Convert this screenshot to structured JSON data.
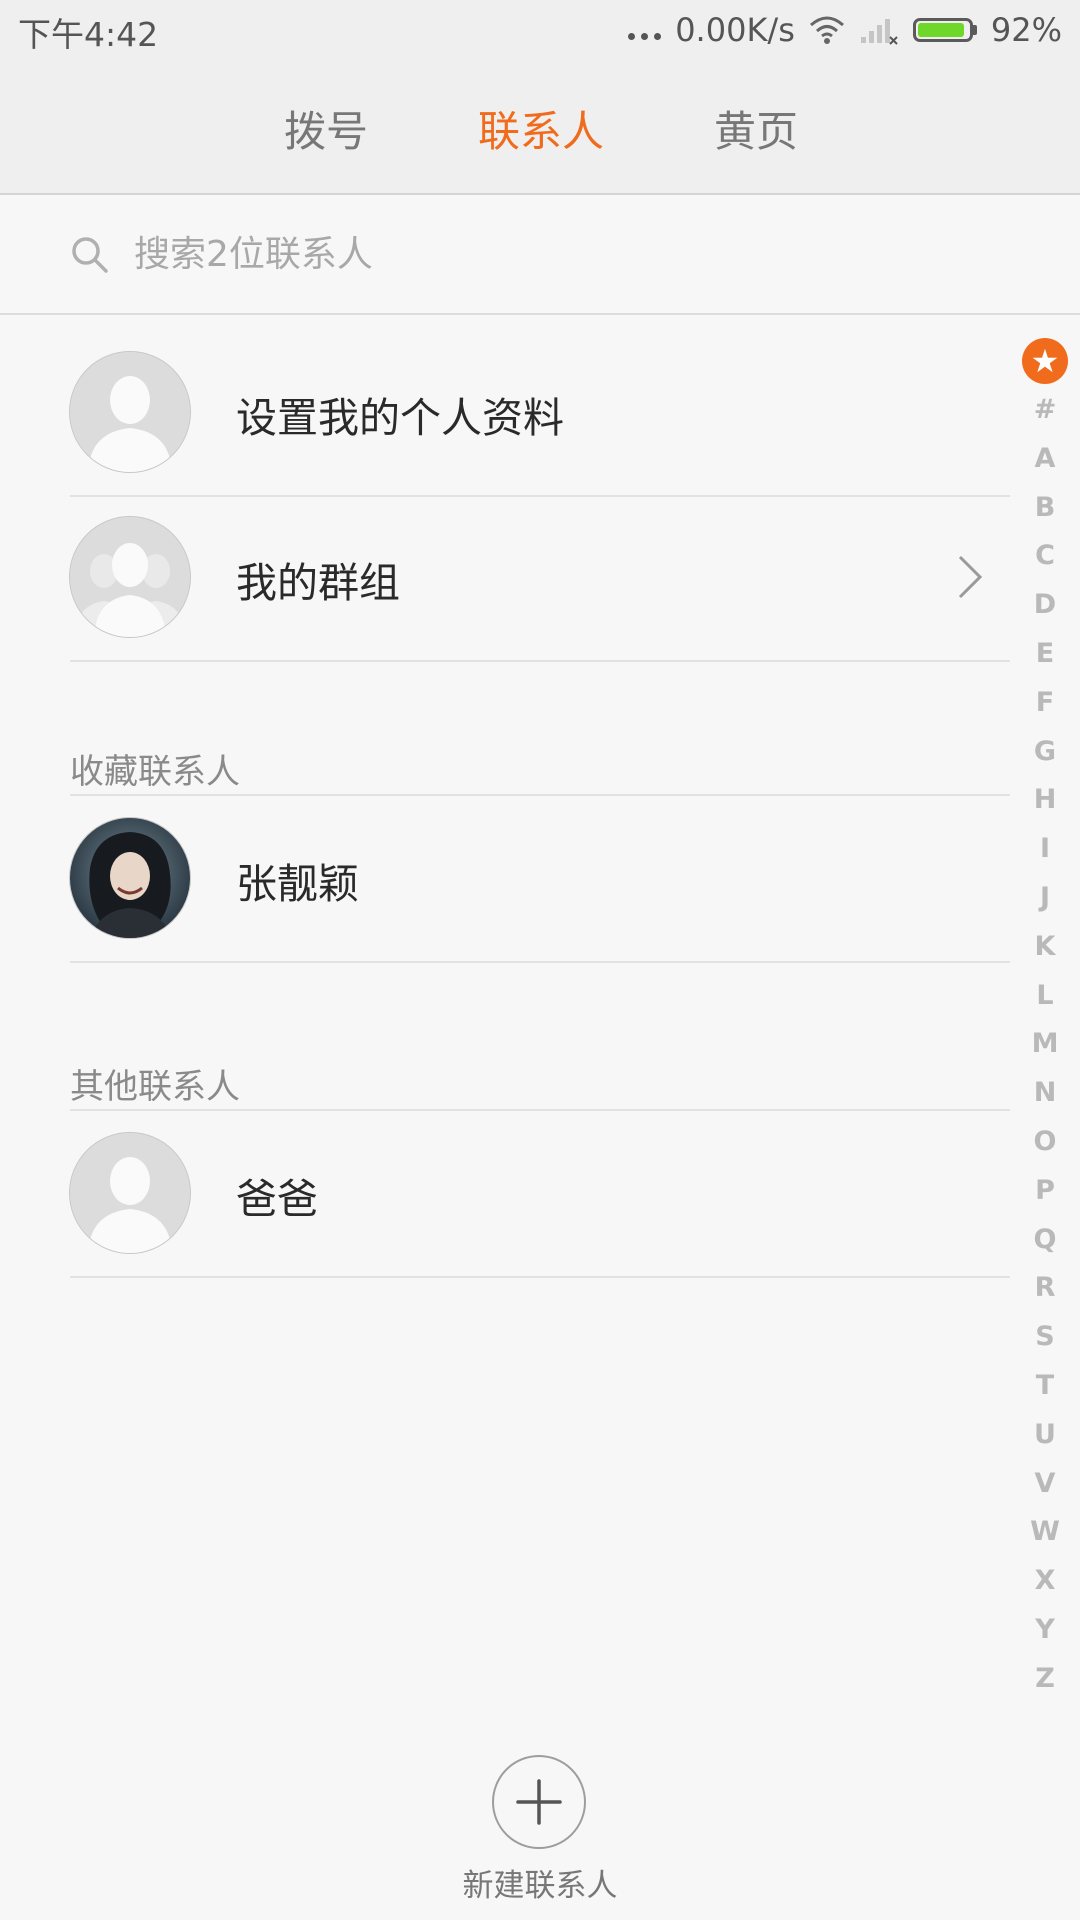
{
  "status": {
    "time": "下午4:42",
    "speed": "0.00K/s",
    "battery": "92%",
    "battery_level": 0.92,
    "icons": [
      "more-dots-icon",
      "wifi-icon",
      "signal-off-icon",
      "battery-icon"
    ]
  },
  "tabs": [
    {
      "label": "拨号",
      "active": false
    },
    {
      "label": "联系人",
      "active": true
    },
    {
      "label": "黄页",
      "active": false
    }
  ],
  "search": {
    "placeholder": "搜索2位联系人",
    "value": ""
  },
  "top_items": [
    {
      "label": "设置我的个人资料",
      "icon": "person-avatar-icon"
    },
    {
      "label": "我的群组",
      "icon": "group-avatar-icon",
      "trailing": "chevron-right-icon"
    }
  ],
  "sections": [
    {
      "title": "收藏联系人",
      "contacts": [
        {
          "name": "张靓颖",
          "avatar": "photo"
        }
      ]
    },
    {
      "title": "其他联系人",
      "contacts": [
        {
          "name": "爸爸",
          "avatar": "default"
        }
      ]
    }
  ],
  "index_bar": {
    "favorite_symbol": "★",
    "letters": [
      "#",
      "A",
      "B",
      "C",
      "D",
      "E",
      "F",
      "G",
      "H",
      "I",
      "J",
      "K",
      "L",
      "M",
      "N",
      "O",
      "P",
      "Q",
      "R",
      "S",
      "T",
      "U",
      "V",
      "W",
      "X",
      "Y",
      "Z"
    ]
  },
  "fab": {
    "label": "新建联系人",
    "icon": "plus-icon"
  },
  "colors": {
    "accent": "#f06c1c",
    "battery": "#6fd62a",
    "background": "#f7f7f7"
  }
}
